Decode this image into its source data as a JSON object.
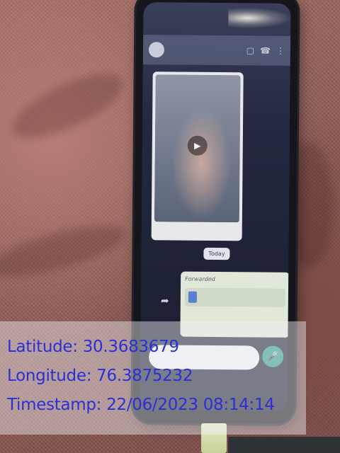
{
  "overlay": {
    "latitude_text": "Latitude: 30.3683679",
    "longitude_text": "Longitude: 76.3875232",
    "timestamp_text": "Timestamp: 22/06/2023 08:14:14",
    "text_color": "#2b2fd6"
  },
  "chat": {
    "date_chip": "Today",
    "forwarded_label": "Forwarded",
    "icons": [
      "avatar",
      "video-call-icon",
      "phone-icon",
      "more-icon",
      "play-icon",
      "share-icon",
      "mic-icon"
    ]
  },
  "colors": {
    "fabric": "#8e5e58",
    "phone_body": "#15151b",
    "mic_button": "#2c9c82"
  }
}
